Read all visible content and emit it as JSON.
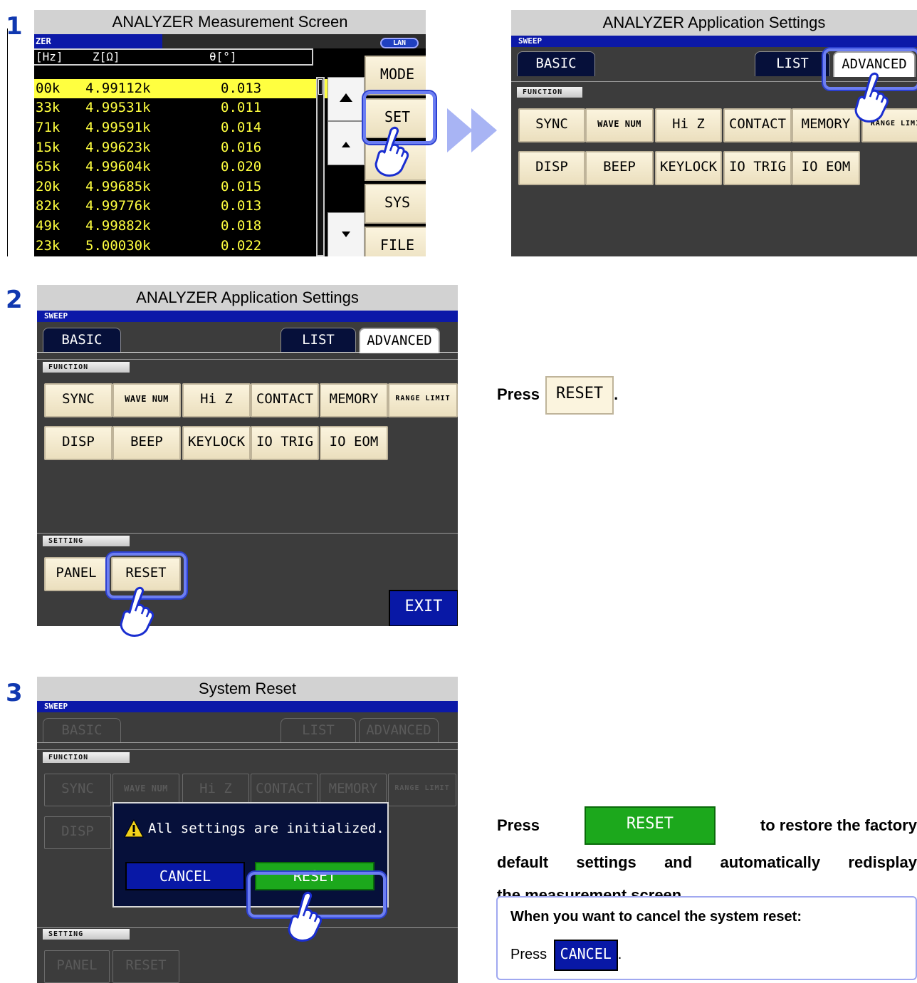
{
  "step1": {
    "number": "1",
    "measurement_screen": {
      "title": "ANALYZER Measurement Screen",
      "mode_label": "ZER",
      "lan_badge": "LAN",
      "columns": [
        "[Hz]",
        "Z[Ω]",
        "θ[°]"
      ],
      "rows": [
        {
          "freq": "00k",
          "z": "4.99112k",
          "theta": "0.013"
        },
        {
          "freq": "33k",
          "z": "4.99531k",
          "theta": "0.011"
        },
        {
          "freq": "71k",
          "z": "4.99591k",
          "theta": "0.014"
        },
        {
          "freq": "15k",
          "z": "4.99623k",
          "theta": "0.016"
        },
        {
          "freq": "65k",
          "z": "4.99604k",
          "theta": "0.020"
        },
        {
          "freq": "20k",
          "z": "4.99685k",
          "theta": "0.015"
        },
        {
          "freq": "82k",
          "z": "4.99776k",
          "theta": "0.013"
        },
        {
          "freq": "49k",
          "z": "4.99882k",
          "theta": "0.018"
        },
        {
          "freq": "23k",
          "z": "5.00030k",
          "theta": "0.022"
        }
      ],
      "side_buttons": [
        "MODE",
        "SET",
        "",
        "SYS",
        "FILE"
      ]
    },
    "app_settings": {
      "title": "ANALYZER Application Settings",
      "strip": "SWEEP",
      "tabs": {
        "basic": "BASIC",
        "list": "LIST",
        "advanced": "ADVANCED"
      },
      "function_label": "FUNCTION",
      "row1": [
        "SYNC",
        "WAVE NUM",
        "Hi Z",
        "CONTACT",
        "MEMORY",
        "RANGE LIMI"
      ],
      "row2": [
        "DISP",
        "BEEP",
        "KEYLOCK",
        "IO TRIG",
        "IO EOM"
      ]
    }
  },
  "step2": {
    "number": "2",
    "screen": {
      "title": "ANALYZER Application Settings",
      "strip": "SWEEP",
      "tabs": {
        "basic": "BASIC",
        "list": "LIST",
        "advanced": "ADVANCED"
      },
      "function_label": "FUNCTION",
      "row1": [
        "SYNC",
        "WAVE NUM",
        "Hi Z",
        "CONTACT",
        "MEMORY",
        "RANGE LIMIT"
      ],
      "row2": [
        "DISP",
        "BEEP",
        "KEYLOCK",
        "IO TRIG",
        "IO EOM"
      ],
      "setting_label": "SETTING",
      "panel": "PANEL",
      "reset": "RESET",
      "exit": "EXIT"
    },
    "instruction": {
      "press": "Press",
      "button": "RESET",
      "period": "."
    }
  },
  "step3": {
    "number": "3",
    "screen": {
      "title": "System Reset",
      "strip": "SWEEP",
      "tabs": {
        "basic": "BASIC",
        "list": "LIST",
        "advanced": "ADVANCED"
      },
      "function_label": "FUNCTION",
      "row1": [
        "SYNC",
        "WAVE NUM",
        "Hi Z",
        "CONTACT",
        "MEMORY",
        "RANGE LIMIT"
      ],
      "row2": [
        "DISP"
      ],
      "setting_label": "SETTING",
      "panel": "PANEL",
      "reset": "RESET",
      "dialog": {
        "message": "All settings are initialized.",
        "cancel": "CANCEL",
        "reset": "RESET"
      }
    },
    "instruction": {
      "press": "Press",
      "button": "RESET",
      "line1_rest": "to restore the factory",
      "line2": "default settings and automatically redisplay",
      "line3": "the measurement screen."
    },
    "note": {
      "heading": "When you want to cancel the system reset:",
      "press": "Press",
      "button": "CANCEL",
      "period": "."
    }
  },
  "colors": {
    "step_number": "#1038b0",
    "title_bar": "#d2d2d2",
    "strip": "#0c19a8",
    "highlight": "#6c7ef2",
    "reset_green": "#1ca81c",
    "cancel_blue": "#0818a6"
  }
}
